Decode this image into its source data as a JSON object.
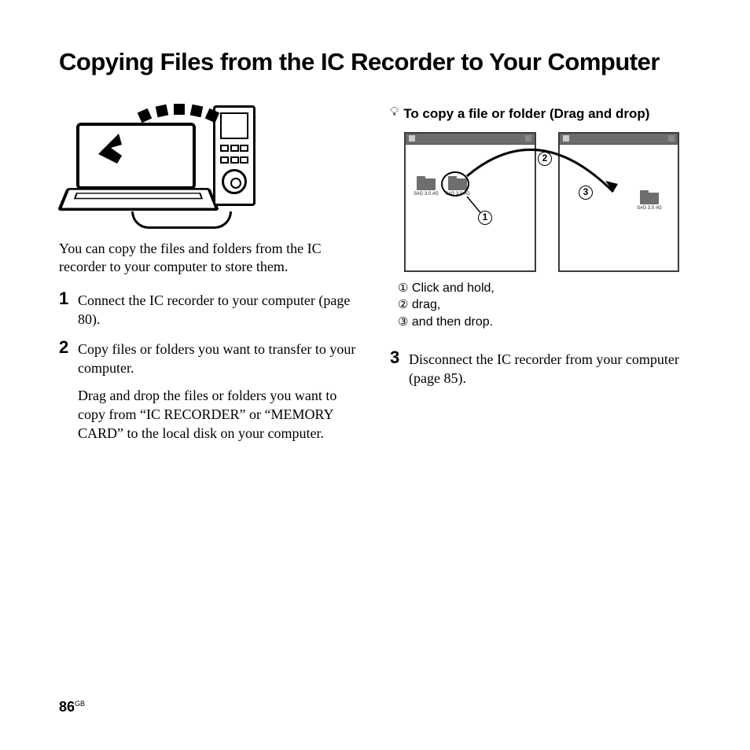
{
  "title": "Copying Files from the IC Recorder to Your Computer",
  "intro": "You can copy the files and folders from the IC recorder to your computer to store them.",
  "steps": {
    "s1": {
      "num": "1",
      "text": "Connect the IC recorder to your computer (page 80)."
    },
    "s2": {
      "num": "2",
      "text": "Copy files or folders you want to transfer to your computer.",
      "text2": "Drag and drop the files or folders you want to copy from “IC RECORDER” or “MEMORY CARD” to the local disk on your computer."
    },
    "s3": {
      "num": "3",
      "text": "Disconnect the IC recorder from your computer (page 85)."
    }
  },
  "tip": {
    "heading": "To copy a file or folder (Drag and drop)",
    "legend1": " Click and hold,",
    "legend2": " drag,",
    "legend3": " and then drop.",
    "n1": "①",
    "n2": "②",
    "n3": "③"
  },
  "callouts": {
    "c1": "1",
    "c2": "2",
    "c3": "3"
  },
  "page_number": "86",
  "page_region": "GB"
}
